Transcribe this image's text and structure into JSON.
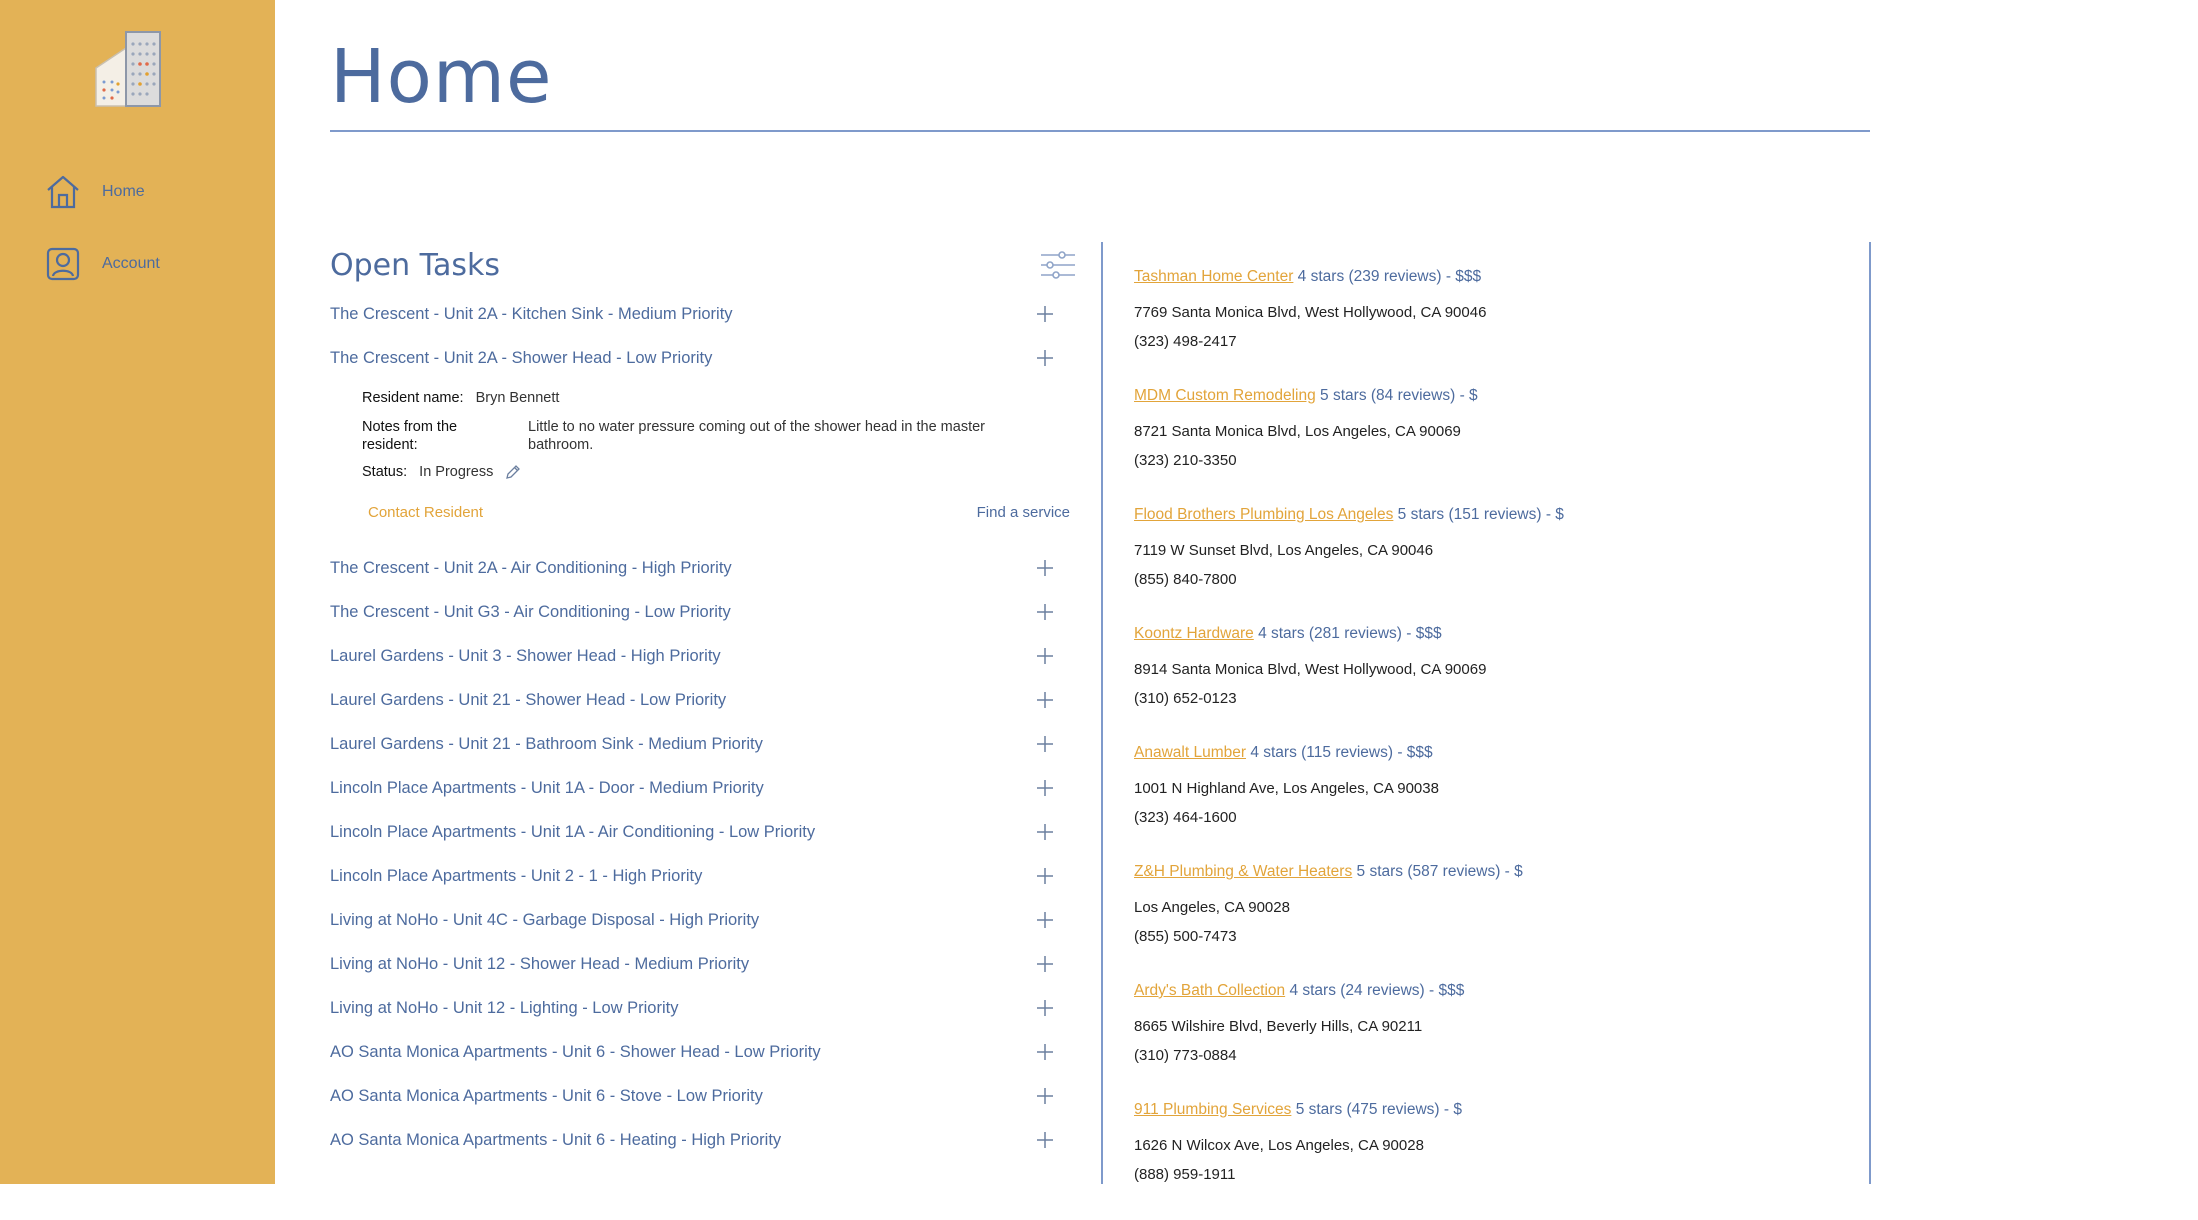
{
  "sidebar": {
    "items": [
      {
        "label": "Home",
        "icon": "home-icon"
      },
      {
        "label": "Account",
        "icon": "account-icon"
      }
    ]
  },
  "header": {
    "title": "Home"
  },
  "tasks": {
    "title": "Open Tasks",
    "items": [
      "The Crescent - Unit 2A - Kitchen Sink - Medium Priority",
      "The Crescent - Unit 2A - Shower Head - Low Priority",
      "The Crescent - Unit 2A - Air Conditioning - High Priority",
      "The Crescent - Unit G3 - Air Conditioning - Low Priority",
      "Laurel Gardens - Unit 3 - Shower Head - High Priority",
      "Laurel Gardens - Unit 21 - Shower Head - Low Priority",
      "Laurel Gardens - Unit 21 - Bathroom Sink - Medium Priority",
      "Lincoln Place Apartments - Unit 1A - Door - Medium Priority",
      "Lincoln Place Apartments - Unit 1A - Air Conditioning - Low Priority",
      "Lincoln Place Apartments - Unit 2 - 1 - High Priority",
      "Living at NoHo - Unit 4C - Garbage Disposal - High Priority",
      "Living at NoHo - Unit 12 - Shower Head - Medium Priority",
      "Living at NoHo - Unit 12 - Lighting - Low Priority",
      "AO Santa Monica Apartments - Unit 6 - Shower Head - Low Priority",
      "AO Santa Monica Apartments - Unit 6 - Stove - Low Priority",
      "AO Santa Monica Apartments - Unit 6 - Heating - High Priority"
    ],
    "detail": {
      "resident_key": "Resident name:",
      "resident_val": "Bryn Bennett",
      "notes_key_1": "Notes from the",
      "notes_key_2": "resident:",
      "notes_val_1": "Little to no water pressure coming out of the shower head in the master",
      "notes_val_2": "bathroom.",
      "status_key": "Status:",
      "status_val": "In Progress",
      "contact_label": "Contact Resident",
      "find_label": "Find a service"
    }
  },
  "services": [
    {
      "name": "Tashman Home Center",
      "rating": " 4 stars (239 reviews) - $$$",
      "address": "7769 Santa Monica Blvd, West Hollywood, CA 90046",
      "phone": "(323) 498-2417"
    },
    {
      "name": "MDM Custom Remodeling",
      "rating": " 5 stars (84 reviews) - $",
      "address": "8721 Santa Monica Blvd, Los Angeles, CA 90069",
      "phone": "(323) 210-3350"
    },
    {
      "name": "Flood Brothers Plumbing Los Angeles",
      "rating": " 5 stars (151 reviews) - $",
      "address": "7119 W Sunset Blvd, Los Angeles, CA 90046",
      "phone": "(855) 840-7800"
    },
    {
      "name": "Koontz Hardware",
      "rating": " 4 stars (281 reviews) - $$$",
      "address": "8914 Santa Monica Blvd, West Hollywood, CA 90069",
      "phone": "(310) 652-0123"
    },
    {
      "name": "Anawalt Lumber",
      "rating": " 4 stars (115 reviews) - $$$",
      "address": "1001 N Highland Ave, Los Angeles, CA 90038",
      "phone": "(323) 464-1600"
    },
    {
      "name": "Z&H Plumbing & Water Heaters",
      "rating": " 5 stars (587 reviews) - $",
      "address": "Los Angeles, CA 90028",
      "phone": "(855) 500-7473"
    },
    {
      "name": "Ardy's Bath Collection",
      "rating": " 4 stars (24 reviews) - $$$",
      "address": "8665 Wilshire Blvd, Beverly Hills, CA 90211",
      "phone": "(310) 773-0884"
    },
    {
      "name": "911 Plumbing Services",
      "rating": " 5 stars (475 reviews) - $",
      "address": "1626 N Wilcox Ave, Los Angeles, CA 90028",
      "phone": "(888) 959-1911"
    }
  ],
  "colors": {
    "sidebar": "#e3b256",
    "accent_blue": "#4d6b9e",
    "accent_orange": "#e2a43a"
  }
}
